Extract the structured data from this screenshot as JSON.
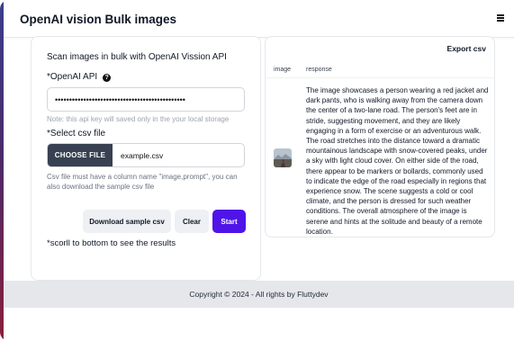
{
  "app": {
    "title": "OpenAI vision Bulk images",
    "menu_icon": "hamburger-menu-icon"
  },
  "form": {
    "section_title": "Scan images in bulk with OpenAI Vission API",
    "api_label": "*OpenAI API",
    "help_icon": "question-circle-icon",
    "api_value": "••••••••••••••••••••••••••••••••••••••••••••••",
    "api_note": "Note: this api key will saved only in the your local storage",
    "csv_label": "*Select csv file",
    "choose_file_label": "CHOOSE FILE",
    "file_name": "example.csv",
    "csv_note": "Csv file must have a column name \"image,prompt\", you can also download the sample csv file",
    "download_label": "Download sample csv",
    "clear_label": "Clear",
    "start_label": "Start",
    "scroll_note": "*scorll to bottom to see the results"
  },
  "results": {
    "export_label": "Export csv",
    "columns": [
      "image",
      "response"
    ],
    "rows": [
      {
        "image_icon": "road-thumbnail-image",
        "response": "The image showcases a person wearing a red jacket and dark pants, who is walking away from the camera down the center of a two-lane road. The person's feet are in stride, suggesting movement, and they are likely engaging in a form of exercise or an adventurous walk. The road stretches into the distance toward a dramatic mountainous landscape with snow-covered peaks, under a sky with light cloud cover. On either side of the road, there appear to be markers or bollards, commonly used to indicate the edge of the road especially in regions that experience snow. The scene suggests a cold or cool climate, and the person is dressed for such weather conditions. The overall atmosphere of the image is serene and hints at the solitude and beauty of a remote location."
      }
    ]
  },
  "footer": {
    "copyright": "Copyright © 2024 - All rights by Fluttydev"
  },
  "colors": {
    "primary": "#4f14e8",
    "choose_file_bg": "#374151",
    "footer_bg": "#e5e7eb"
  }
}
